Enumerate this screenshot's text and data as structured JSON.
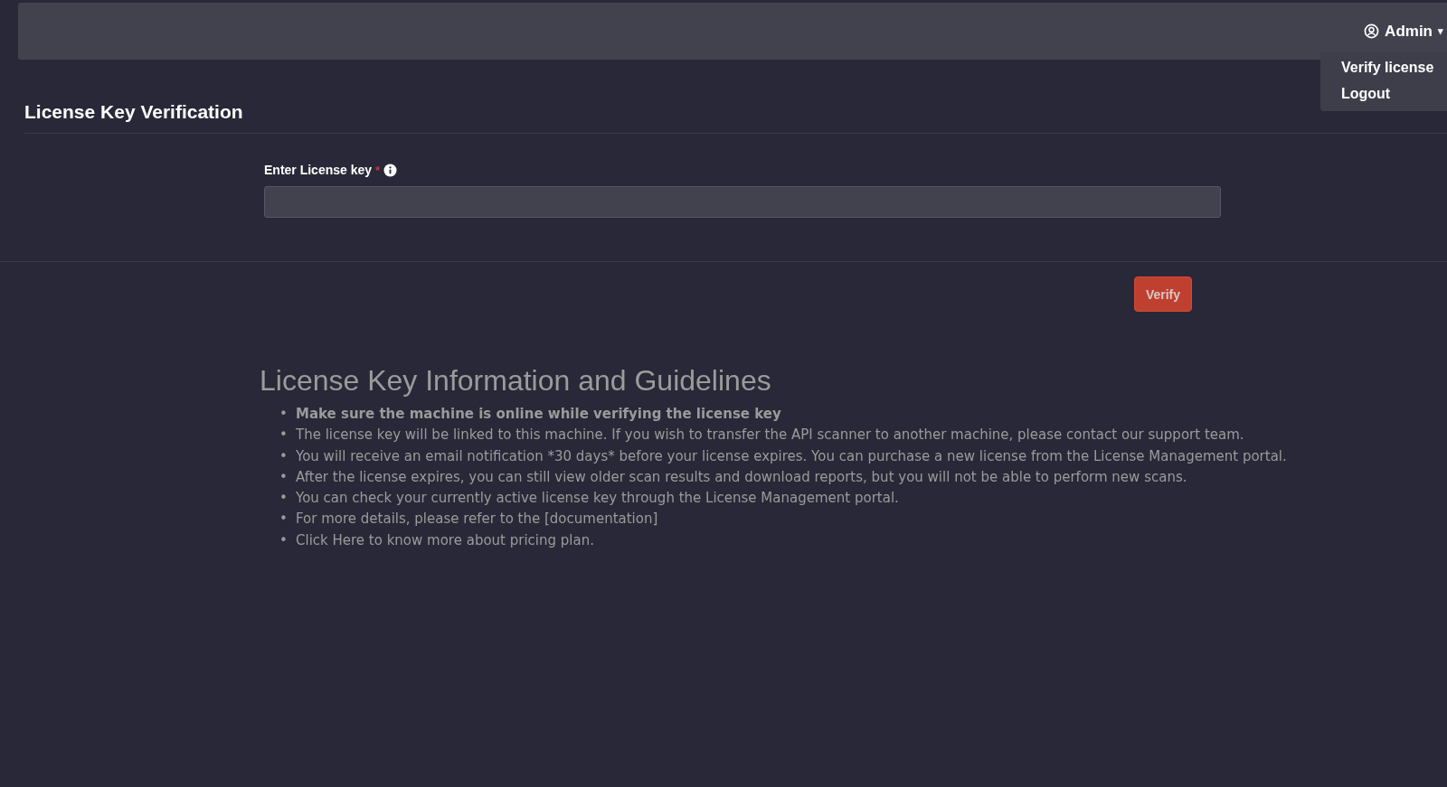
{
  "top_bar": {
    "user_menu": {
      "label": "Admin",
      "caret": "▾",
      "items": [
        {
          "label": "Verify license"
        },
        {
          "label": "Logout"
        }
      ]
    }
  },
  "page_title": "License Key Verification",
  "form": {
    "label": "Enter License key",
    "required_mark": "*",
    "button": "Verify"
  },
  "guidelines": {
    "heading": "License Key Information and Guidelines",
    "items": [
      {
        "kind": "emphasis",
        "bullet": "•",
        "text": "Make sure the machine is online while verifying the license key"
      },
      {
        "kind": "plain",
        "bullet": "•",
        "text": "The license key will be linked to this machine. If you wish to transfer the API scanner to another machine, please contact our support team."
      },
      {
        "kind": "plain",
        "bullet": "•",
        "text": "You will receive an email notification *30 days* before your license expires. You can purchase a new license from the License Management portal."
      },
      {
        "kind": "plain",
        "bullet": "•",
        "text": "After the license expires, you can still view older scan results and download reports, but you will not be able to perform new scans."
      },
      {
        "kind": "plain",
        "bullet": "•",
        "text": "You can check your currently active license key through the License Management portal."
      },
      {
        "kind": "plain",
        "bullet": "•",
        "text": "For more details, please refer to the [documentation]"
      },
      {
        "kind": "plain",
        "bullet": "•",
        "text": "Click Here to know more about pricing plan."
      }
    ]
  }
}
